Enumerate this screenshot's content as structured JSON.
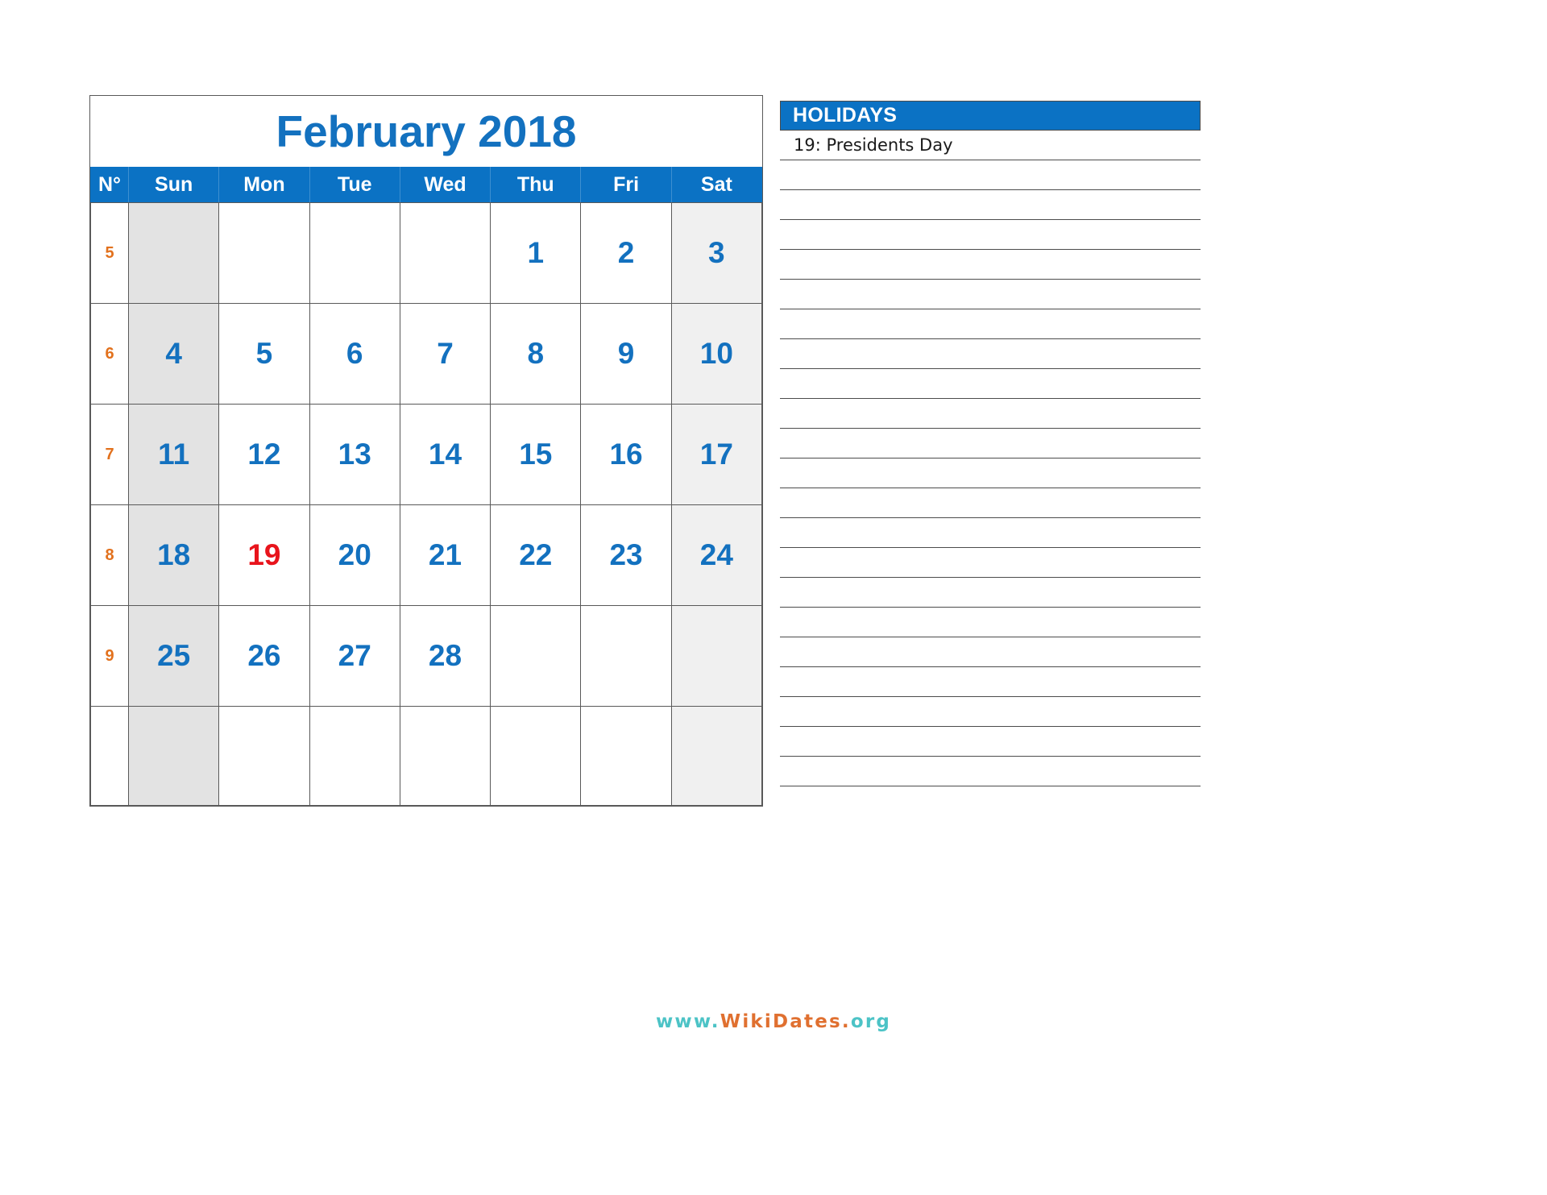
{
  "calendar": {
    "title": "February 2018",
    "columns": [
      "N°",
      "Sun",
      "Mon",
      "Tue",
      "Wed",
      "Thu",
      "Fri",
      "Sat"
    ],
    "weeks": [
      {
        "number": "5",
        "days": [
          "",
          "",
          "",
          "",
          "1",
          "2",
          "3"
        ]
      },
      {
        "number": "6",
        "days": [
          "4",
          "5",
          "6",
          "7",
          "8",
          "9",
          "10"
        ]
      },
      {
        "number": "7",
        "days": [
          "11",
          "12",
          "13",
          "14",
          "15",
          "16",
          "17"
        ]
      },
      {
        "number": "8",
        "days": [
          "18",
          "19",
          "20",
          "21",
          "22",
          "23",
          "24"
        ]
      },
      {
        "number": "9",
        "days": [
          "25",
          "26",
          "27",
          "28",
          "",
          "",
          ""
        ]
      },
      {
        "number": "",
        "days": [
          "",
          "",
          "",
          "",
          "",
          "",
          ""
        ]
      }
    ],
    "highlighted_days": [
      "19"
    ]
  },
  "holidays": {
    "header": "HOLIDAYS",
    "entries": [
      "19: Presidents Day",
      "",
      "",
      "",
      "",
      "",
      "",
      "",
      "",
      "",
      "",
      "",
      "",
      "",
      "",
      "",
      "",
      "",
      "",
      "",
      "",
      ""
    ]
  },
  "footer": {
    "brand_prefix": "www.",
    "brand_name": "WikiDates.",
    "brand_suffix": "org"
  },
  "colors": {
    "header_blue": "#0b72c4",
    "day_blue": "#1371bf",
    "week_orange": "#e2711d",
    "holiday_red": "#e8141c",
    "sunday_bg": "#e3e3e3",
    "saturday_bg": "#f0f0f0",
    "brand_teal": "#4cc3c6",
    "brand_orange": "#e07030"
  }
}
